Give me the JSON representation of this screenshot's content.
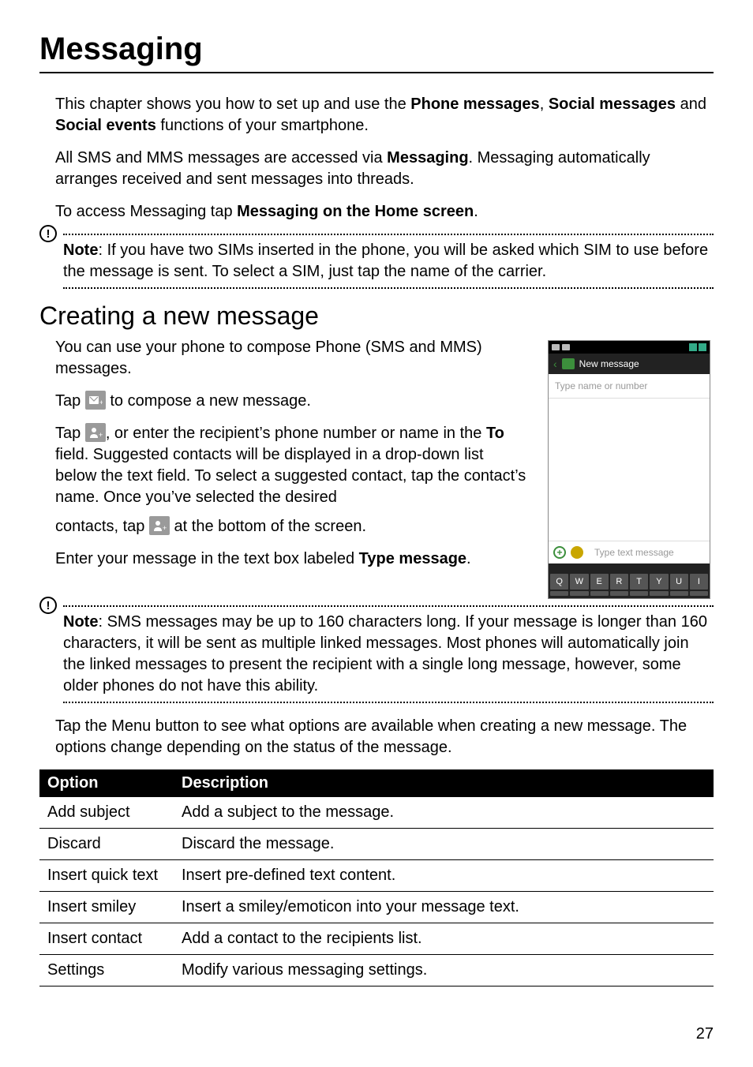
{
  "page_title": "Messaging",
  "intro_p1_a": "This chapter shows you how to set up and use the ",
  "intro_p1_b": "Phone messages",
  "intro_p1_c": ", ",
  "intro_p1_d": "Social messages",
  "intro_p1_e": " and ",
  "intro_p1_f": "Social events",
  "intro_p1_g": " functions of your smartphone.",
  "intro_p2_a": "All SMS and MMS messages are accessed via ",
  "intro_p2_b": "Messaging",
  "intro_p2_c": ". Messaging automatically arranges received and sent messages into threads.",
  "intro_p3_a": "To access Messaging tap ",
  "intro_p3_b": "Messaging on the Home screen",
  "intro_p3_c": ".",
  "note1_a": "Note",
  "note1_b": ": If you have two SIMs inserted in the phone, you will be asked which SIM to use before the message is sent. To select a SIM, just tap the name of the carrier.",
  "section_title": "Creating a new message",
  "sec_p1": "You can use your phone to compose Phone (SMS and MMS) messages.",
  "sec_p2_a": "Tap ",
  "sec_p2_b": " to compose a new message.",
  "sec_p3_a": "Tap ",
  "sec_p3_b": ", or enter the recipient’s phone number or name in the ",
  "sec_p3_c": "To",
  "sec_p3_d": " field. Suggested contacts will be displayed in a drop-down list below the text field. To select a suggested contact, tap the contact’s name. Once you’ve selected the desired",
  "sec_p4_a": "contacts, tap ",
  "sec_p4_b": " at the bottom of the screen.",
  "sec_p5_a": "Enter your message in the text box labeled ",
  "sec_p5_b": "Type message",
  "sec_p5_c": ".",
  "note2_a": "Note",
  "note2_b": ": SMS messages may be up to 160 characters long. If your message is longer than 160 characters, it will be sent as multiple linked messages. Most phones will automatically join the linked messages to present the recipient with a single long message, however, some older phones do not have this ability.",
  "after_note": "Tap the Menu button to see what options are available when creating a new message. The options change depending on the status of the message.",
  "table": {
    "head_option": "Option",
    "head_desc": "Description",
    "rows": [
      {
        "opt": "Add subject",
        "desc": "Add a subject to the message."
      },
      {
        "opt": "Discard",
        "desc": "Discard the message."
      },
      {
        "opt": "Insert quick text",
        "desc": "Insert pre-defined text content."
      },
      {
        "opt": "Insert smiley",
        "desc": "Insert a smiley/emoticon into your message text."
      },
      {
        "opt": "Insert contact",
        "desc": "Add a contact to the recipients list."
      },
      {
        "opt": "Settings",
        "desc": "Modify various messaging settings."
      }
    ]
  },
  "phone": {
    "title": "New message",
    "name_hint": "Type name or number",
    "msg_hint": "Type text message",
    "keys": [
      "Q",
      "W",
      "E",
      "R",
      "T",
      "Y",
      "U",
      "I"
    ]
  },
  "page_number": "27"
}
